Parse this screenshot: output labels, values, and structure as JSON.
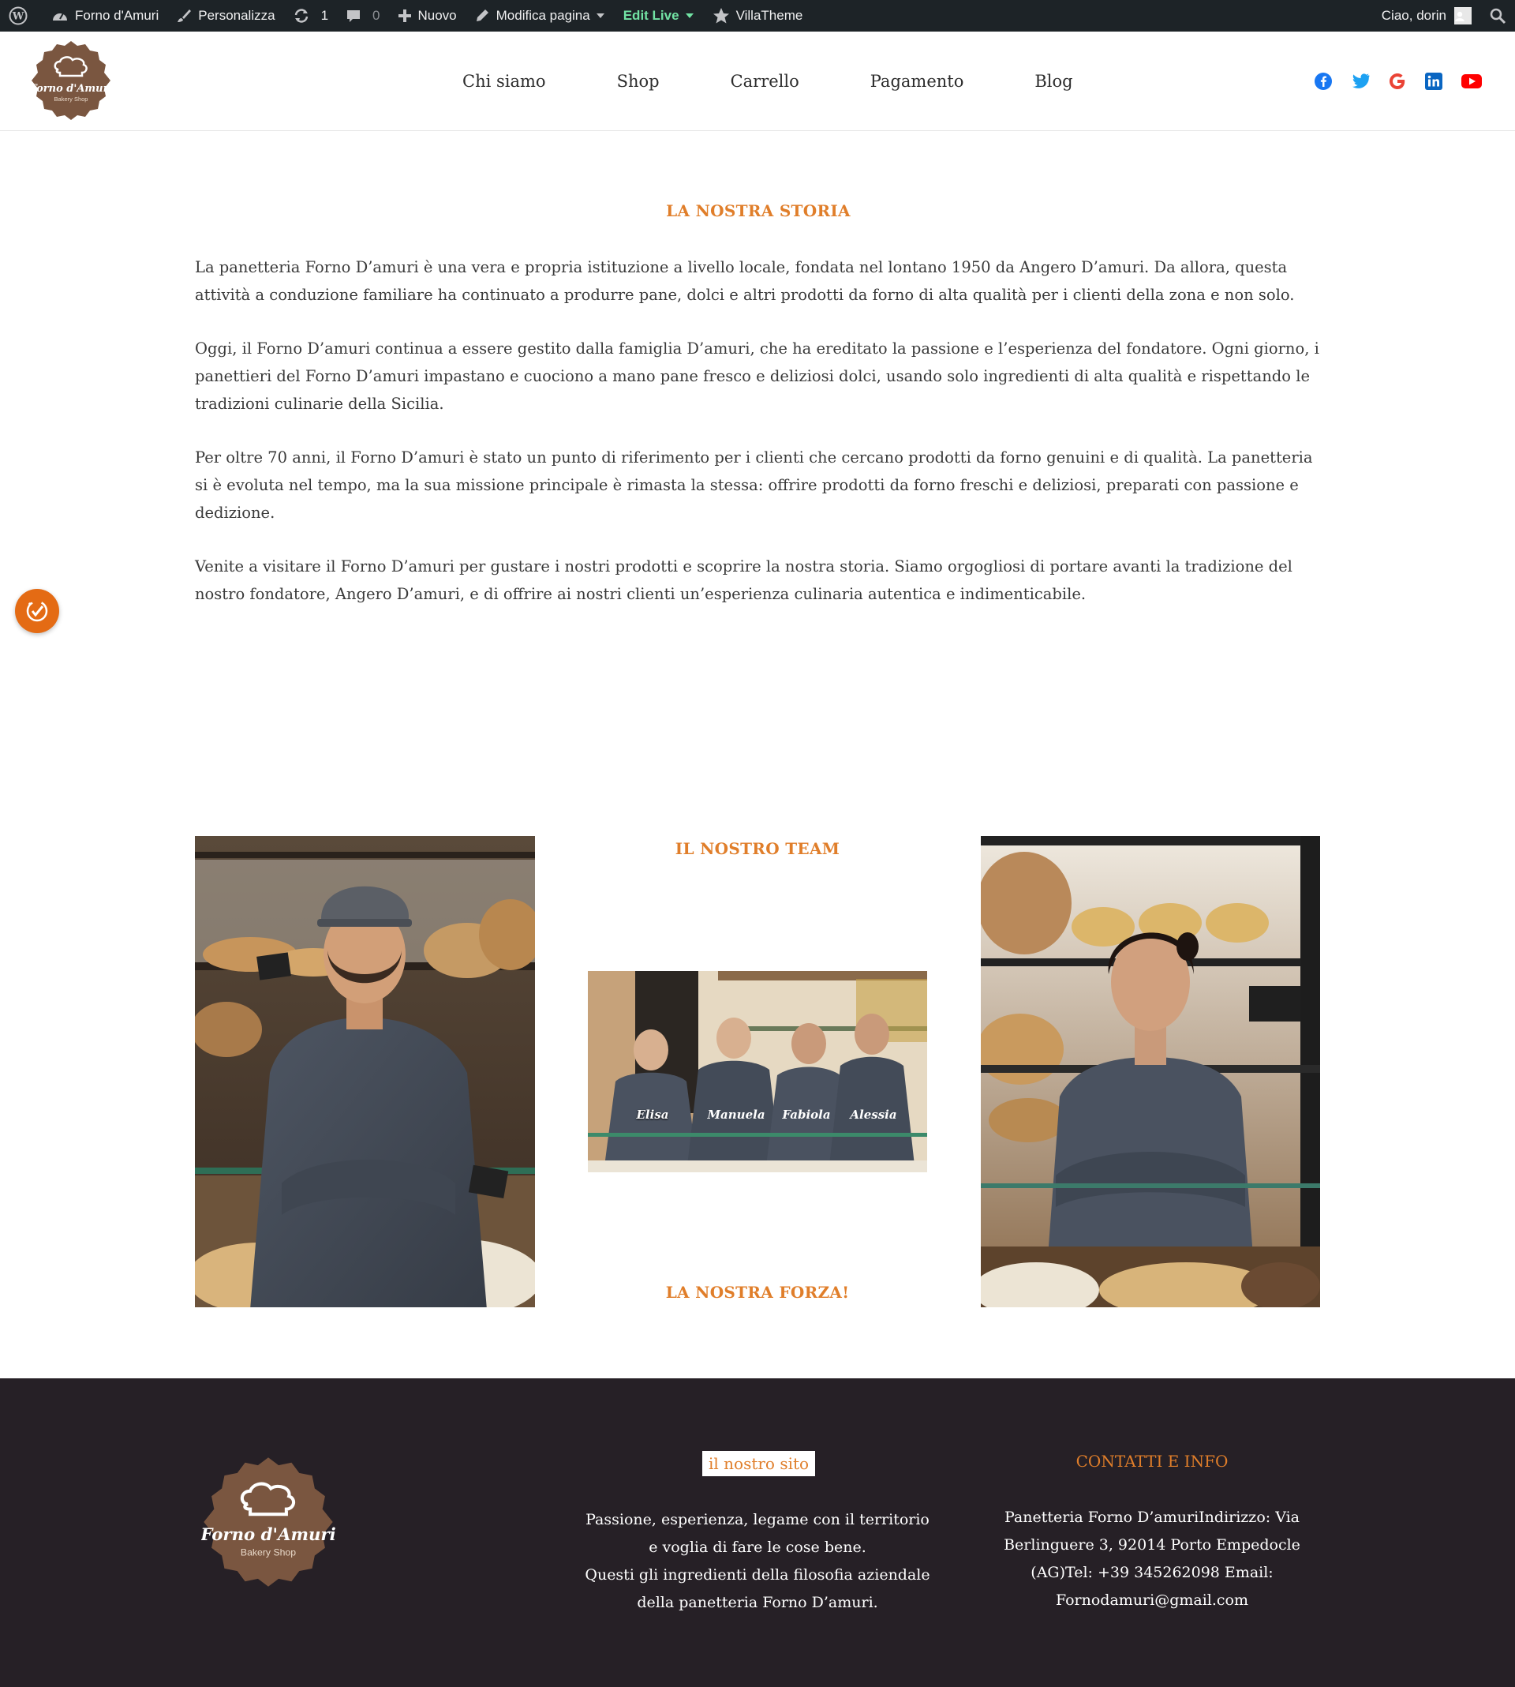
{
  "adminbar": {
    "site_name": "Forno d'Amuri",
    "customize": "Personalizza",
    "updates_count": "1",
    "comments_count": "0",
    "new": "Nuovo",
    "edit_page": "Modifica pagina",
    "edit_live": "Edit Live",
    "villatheme": "VillaTheme",
    "greeting": "Ciao, dorin"
  },
  "header": {
    "logo_title": "Forno d'Amuri",
    "logo_subtitle": "Bakery Shop",
    "nav": [
      "Chi siamo",
      "Shop",
      "Carrello",
      "Pagamento",
      "Blog"
    ]
  },
  "story": {
    "title": "LA NOSTRA STORIA",
    "paragraphs": [
      "La panetteria Forno D’amuri è una vera e propria istituzione a livello locale, fondata nel lontano 1950 da Angero D’amuri. Da allora, questa attività a conduzione familiare ha continuato a produrre pane, dolci e altri prodotti da forno di alta qualità per i clienti della zona e non solo.",
      "Oggi, il Forno D’amuri continua a essere gestito dalla famiglia D’amuri, che ha ereditato la passione e l’esperienza del fondatore. Ogni giorno, i panettieri del Forno D’amuri impastano e cuociono a mano pane fresco e deliziosi dolci, usando solo ingredienti di alta qualità e rispettando le tradizioni culinarie della Sicilia.",
      "Per oltre 70 anni, il Forno D’amuri è stato un punto di riferimento per i clienti che cercano prodotti da forno genuini e di qualità. La panetteria si è evoluta nel tempo, ma la sua missione principale è rimasta la stessa: offrire prodotti da forno freschi e deliziosi, preparati con passione e dedizione.",
      "Venite a visitare il Forno D’amuri per gustare i nostri prodotti e scoprire la nostra storia. Siamo orgogliosi di portare avanti la tradizione del nostro fondatore, Angero D’amuri, e di offrire ai nostri clienti un’esperienza culinaria autentica e indimenticabile."
    ]
  },
  "team": {
    "title": "IL NOSTRO TEAM",
    "group_names": [
      "Elisa",
      "Manuela",
      "Fabiola",
      "Alessia"
    ],
    "strength_title": "LA NOSTRA FORZA!"
  },
  "footer": {
    "site_heading": "il nostro sito",
    "description_lines": [
      "Passione, esperienza, legame con il territorio e voglia di fare le cose bene.",
      "Questi gli ingredienti della filosofia aziendale della panetteria Forno D’amuri."
    ],
    "contact_title": "CONTATTI E INFO",
    "contact_text": "Panetteria Forno D’amuriIndirizzo: Via Berlinguere 3, 92014 Porto Empedocle (AG)Tel: +39 345262098 Email: Fornodamuri@gmail.com"
  },
  "colors": {
    "accent": "#e07e2a",
    "footer_bg": "#262026",
    "adminbar_bg": "#1d2327",
    "logo_brown": "#7a5640"
  }
}
